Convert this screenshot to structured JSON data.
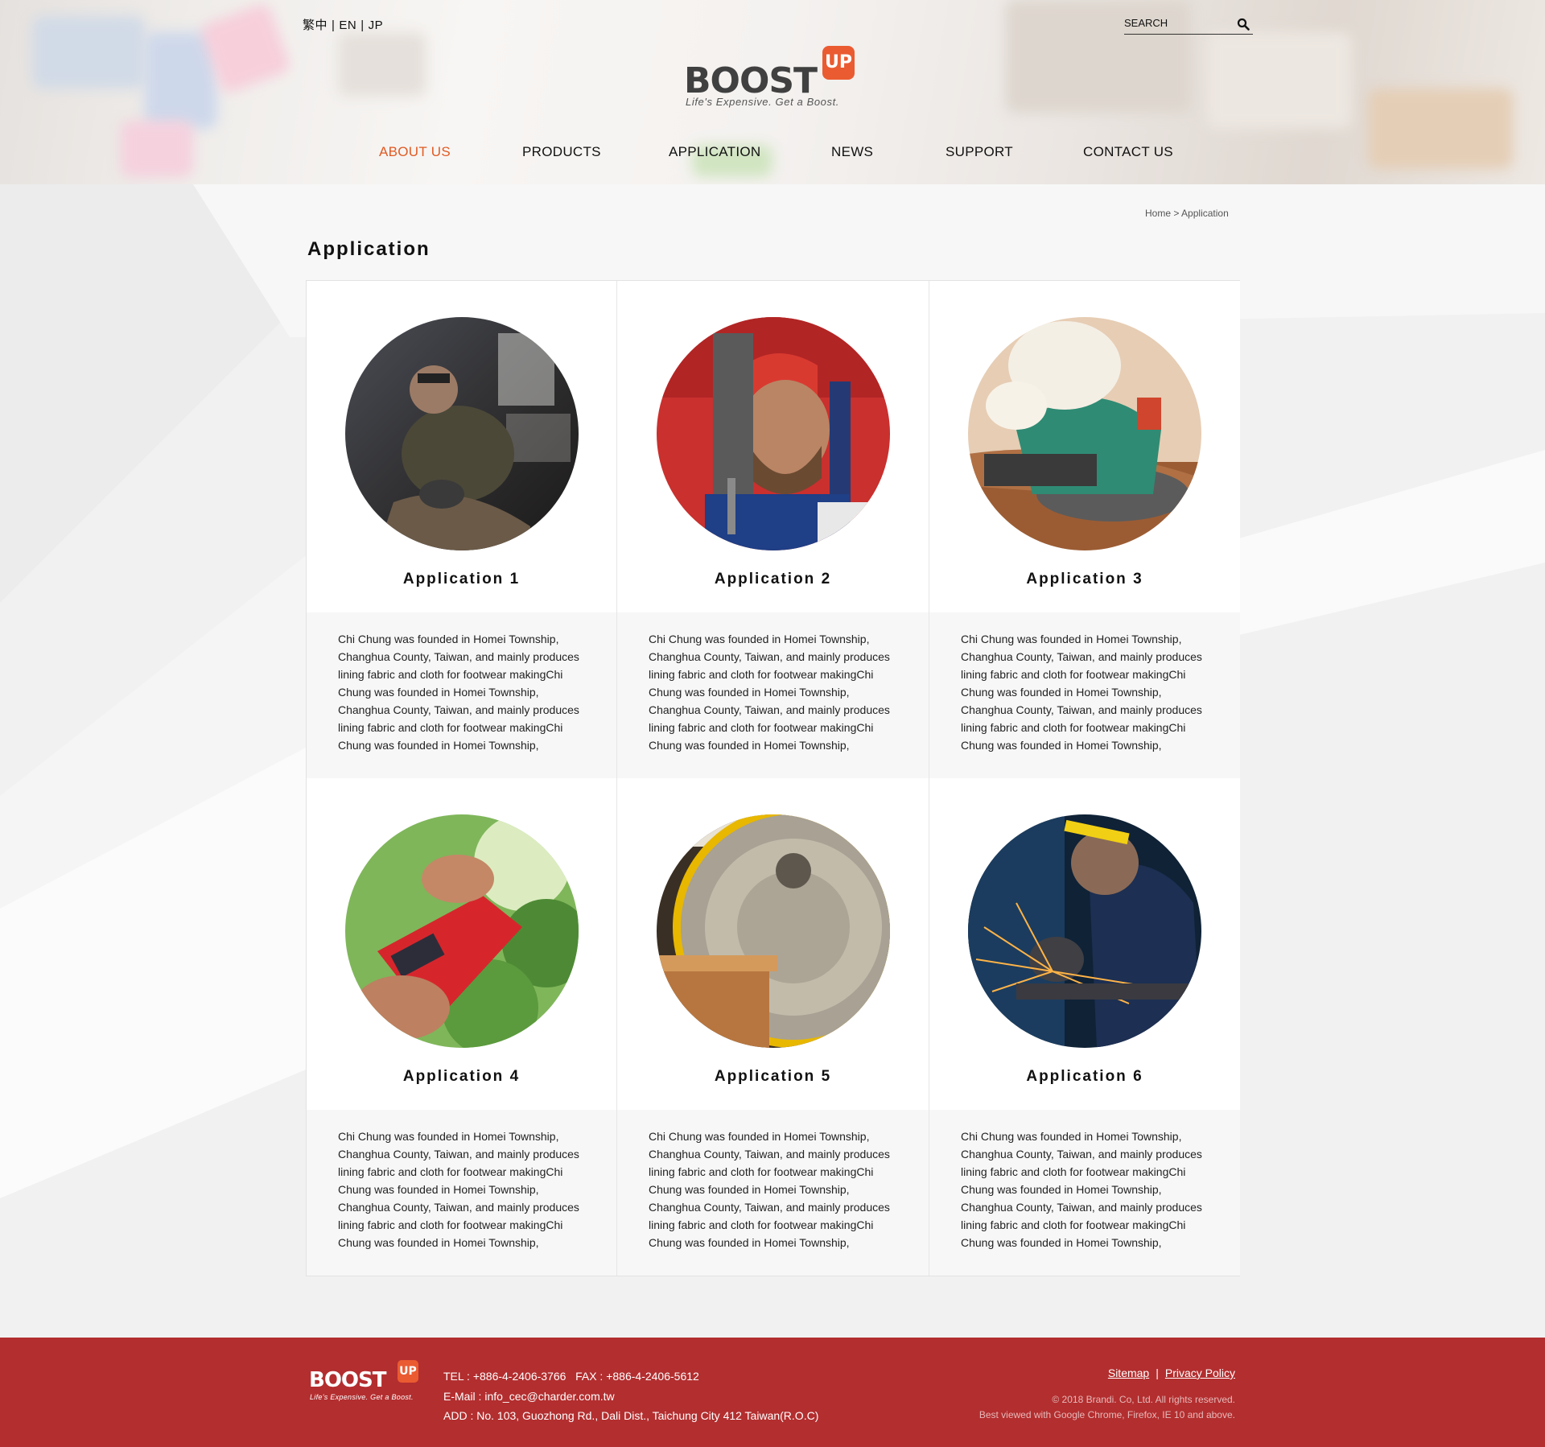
{
  "languages": [
    "繁中",
    "EN",
    "JP"
  ],
  "search": {
    "placeholder": "SEARCH"
  },
  "logo": {
    "word": "BOOST",
    "badge": "UP",
    "tagline": "Life's Expensive. Get a Boost."
  },
  "nav": [
    {
      "label": "ABOUT US",
      "active": true
    },
    {
      "label": "PRODUCTS",
      "active": false
    },
    {
      "label": "APPLICATION",
      "active": false
    },
    {
      "label": "NEWS",
      "active": false
    },
    {
      "label": "SUPPORT",
      "active": false
    },
    {
      "label": "CONTACT US",
      "active": false
    }
  ],
  "breadcrumb": {
    "home": "Home",
    "separator": ">",
    "current": "Application"
  },
  "page_title": "Application",
  "applications": [
    {
      "title": "Application 1",
      "photo": "worker-grinding-photo",
      "description": "Chi Chung was founded in Homei Township, Changhua County, Taiwan, and mainly produces lining fabric and cloth for footwear makingChi Chung was founded in Homei Township, Changhua County, Taiwan, and mainly produces lining fabric and cloth for footwear makingChi Chung was founded in Homei Township,"
    },
    {
      "title": "Application 2",
      "photo": "drill-worker-photo",
      "description": "Chi Chung was founded in Homei Township, Changhua County, Taiwan, and mainly produces lining fabric and cloth for footwear makingChi Chung was founded in Homei Township, Changhua County, Taiwan, and mainly produces lining fabric and cloth for footwear makingChi Chung was founded in Homei Township,"
    },
    {
      "title": "Application 3",
      "photo": "orbital-sander-photo",
      "description": "Chi Chung was founded in Homei Township, Changhua County, Taiwan, and mainly produces lining fabric and cloth for footwear makingChi Chung was founded in Homei Township, Changhua County, Taiwan, and mainly produces lining fabric and cloth for footwear makingChi Chung was founded in Homei Township,"
    },
    {
      "title": "Application 4",
      "photo": "hedge-trimmer-photo",
      "description": "Chi Chung was founded in Homei Township, Changhua County, Taiwan, and mainly produces lining fabric and cloth for footwear makingChi Chung was founded in Homei Township, Changhua County, Taiwan, and mainly produces lining fabric and cloth for footwear makingChi Chung was founded in Homei Township,"
    },
    {
      "title": "Application 5",
      "photo": "circular-saw-photo",
      "description": "Chi Chung was founded in Homei Township, Changhua County, Taiwan, and mainly produces lining fabric and cloth for footwear makingChi Chung was founded in Homei Township, Changhua County, Taiwan, and mainly produces lining fabric and cloth for footwear makingChi Chung was founded in Homei Township,"
    },
    {
      "title": "Application 6",
      "photo": "angle-grinder-sparks-photo",
      "description": "Chi Chung was founded in Homei Township, Changhua County, Taiwan, and mainly produces lining fabric and cloth for footwear makingChi Chung was founded in Homei Township, Changhua County, Taiwan, and mainly produces lining fabric and cloth for footwear makingChi Chung was founded in Homei Township,"
    }
  ],
  "footer": {
    "tel": "TEL : +886-4-2406-3766   FAX : +886-4-2406-5612",
    "email": "E-Mail : info_cec@charder.com.tw",
    "address": "ADD : No. 103, Guozhong Rd., Dali Dist., Taichung City 412 Taiwan(R.O.C)",
    "links": [
      "Sitemap",
      "Privacy Policy"
    ],
    "copyright": "© 2018 Brandi. Co, Ltd. All rights reserved.",
    "browser_note": "Best viewed with Google Chrome, Firefox, IE 10 and above."
  },
  "colors": {
    "accent": "#e05a22",
    "badge": "#ea5b31",
    "footer_bg": "#b32e2f",
    "card_bottom": "#f7f7f7"
  },
  "icons": {
    "search": "search-icon"
  }
}
